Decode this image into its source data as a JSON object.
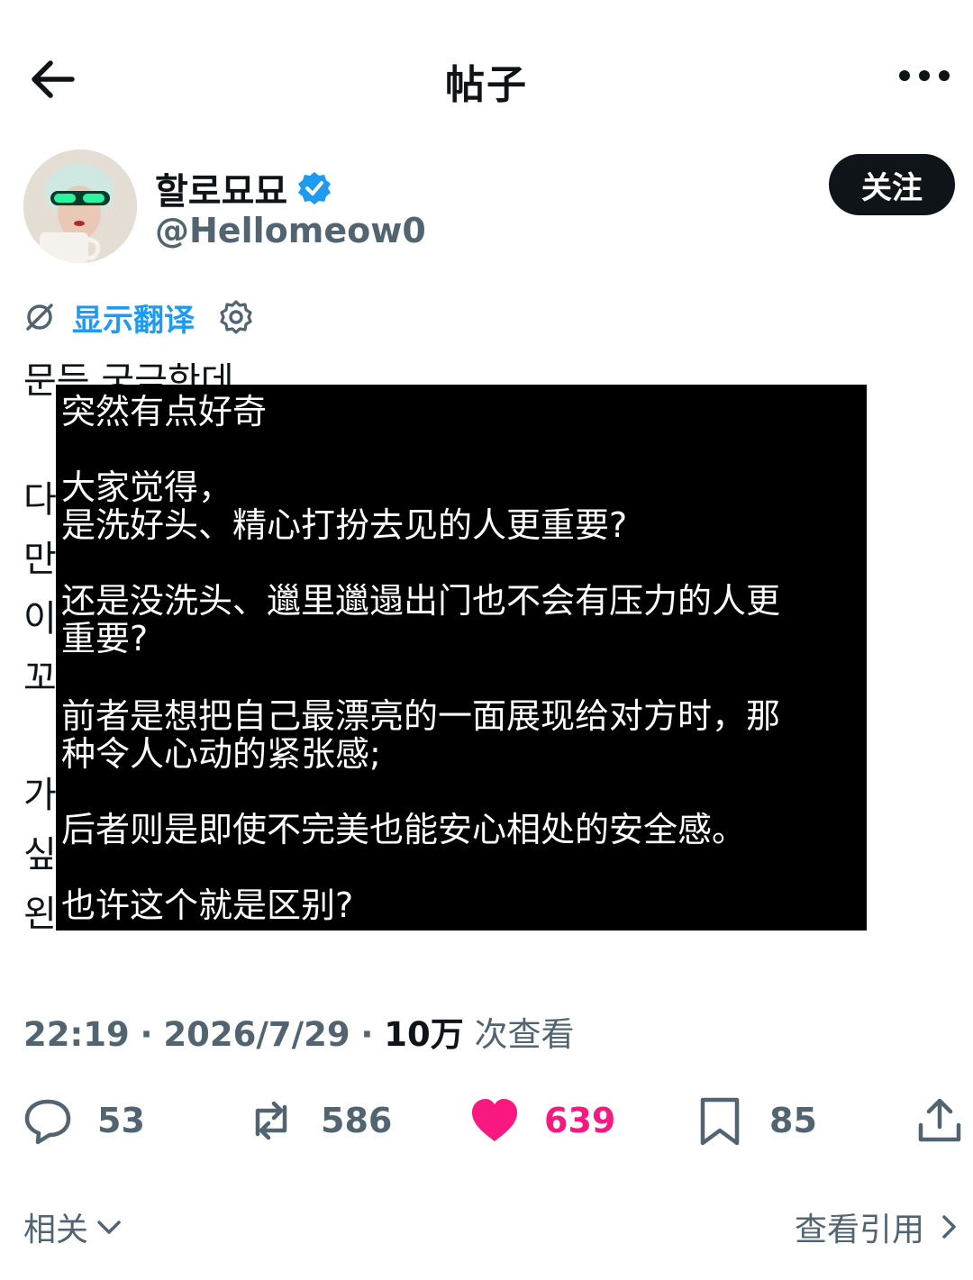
{
  "header": {
    "title": "帖子",
    "back_icon": "arrow-left-icon",
    "more_icon": "more-horizontal-icon"
  },
  "author": {
    "display_name": "할로묘묘",
    "handle": "@Hellomeow0",
    "verified": true,
    "verified_color": "#1d9bf0",
    "follow_label": "关注"
  },
  "translate": {
    "link_label": "显示翻译",
    "icon": "translate-off-icon",
    "settings_icon": "gear-icon"
  },
  "original_text": {
    "line1": "문득 궁금한데",
    "partial": [
      "다",
      "만",
      "이",
      "꼬",
      "가",
      "싶",
      "왼"
    ]
  },
  "overlay_translation": {
    "lines": [
      "突然有点好奇",
      "大家觉得，",
      "是洗好头、精心打扮去见的人更重要?",
      "还是没洗头、邋里邋遢出门也不会有压力的人更",
      "重要?",
      "前者是想把自己最漂亮的一面展现给对方时，那",
      "种令人心动的紧张感;",
      "后者则是即使不完美也能安心相处的安全感。",
      "也许这个就是区别?"
    ]
  },
  "meta": {
    "time": "22:19",
    "date": "2026/7/29",
    "views_count": "10万",
    "views_label": "次查看",
    "separator": "·"
  },
  "actions": {
    "replies": "53",
    "reposts": "586",
    "likes": "639",
    "bookmarks": "85",
    "like_color": "#f91880"
  },
  "bottom": {
    "related_label": "相关",
    "quotes_label": "查看引用"
  }
}
